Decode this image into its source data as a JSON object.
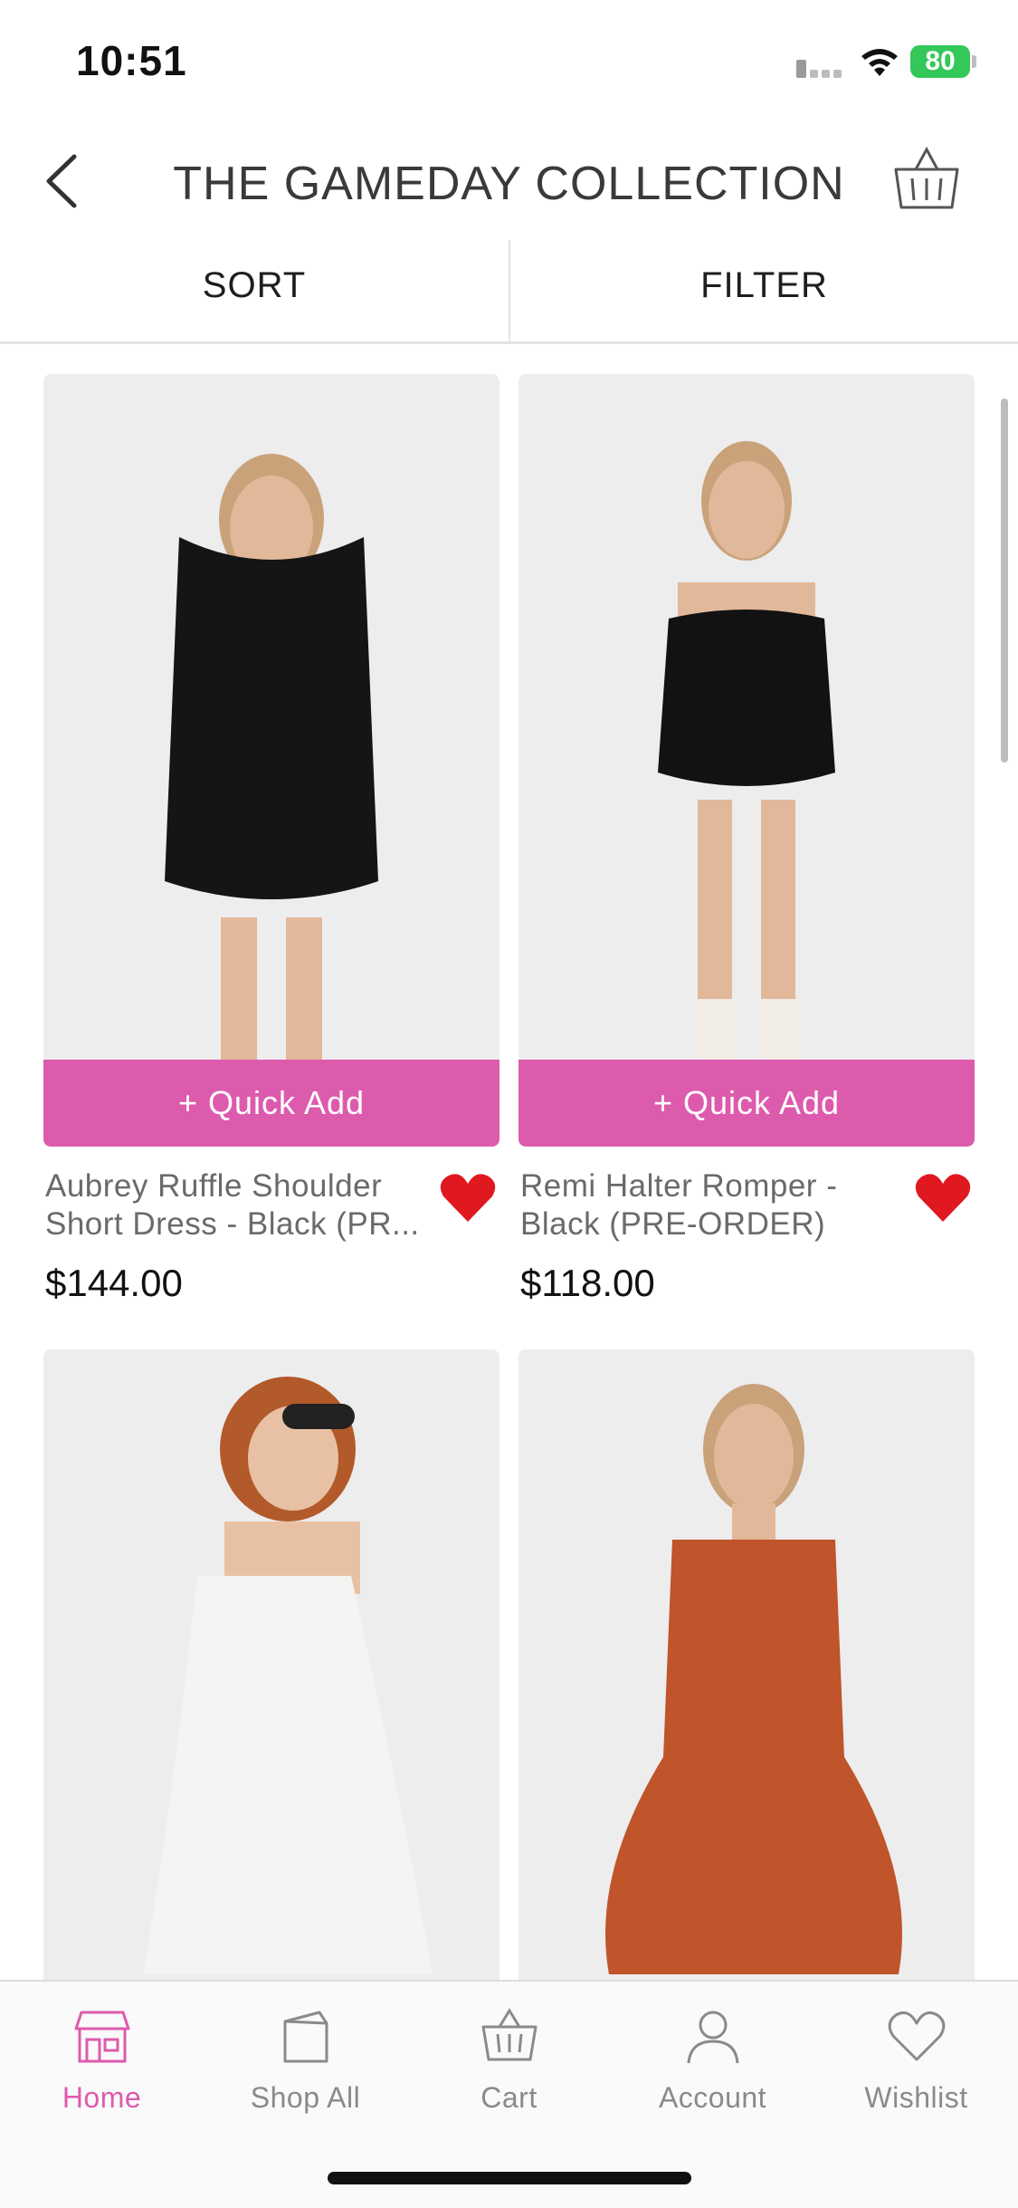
{
  "status_bar": {
    "time": "10:51",
    "battery": "80"
  },
  "header": {
    "title": "THE GAMEDAY COLLECTION"
  },
  "toolbar": {
    "sort_label": "SORT",
    "filter_label": "FILTER"
  },
  "products": [
    {
      "name": "Aubrey Ruffle Shoulder Short Dress - Black (PR...",
      "price": "$144.00",
      "quick_add": "+ Quick Add",
      "dress_color": "#151515"
    },
    {
      "name": "Remi Halter Romper - Black (PRE-ORDER)",
      "price": "$118.00",
      "quick_add": "+ Quick Add",
      "dress_color": "#121212"
    },
    {
      "dress_color": "#f4f4f2"
    },
    {
      "dress_color": "#c0542a"
    }
  ],
  "tabs": [
    {
      "label": "Home",
      "icon": "store-icon",
      "active": true
    },
    {
      "label": "Shop All",
      "icon": "bag-icon",
      "active": false
    },
    {
      "label": "Cart",
      "icon": "basket-icon",
      "active": false
    },
    {
      "label": "Account",
      "icon": "person-icon",
      "active": false
    },
    {
      "label": "Wishlist",
      "icon": "heart-icon",
      "active": false
    }
  ],
  "colors": {
    "accent": "#dd5bad",
    "heart": "#e0181f",
    "battery": "#34c759"
  }
}
